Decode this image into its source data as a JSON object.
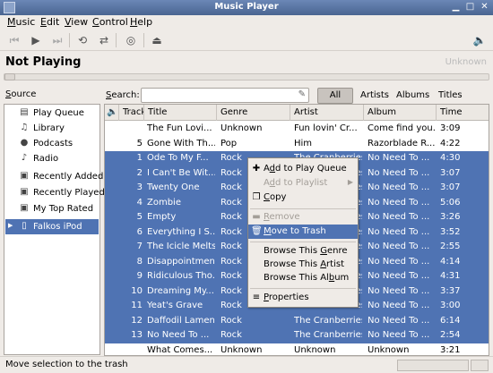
{
  "window": {
    "title": "Music Player"
  },
  "menu": [
    {
      "label": "Music",
      "u": "M",
      "rest": "usic"
    },
    {
      "label": "Edit",
      "u": "E",
      "rest": "dit"
    },
    {
      "label": "View",
      "u": "V",
      "rest": "iew"
    },
    {
      "label": "Control",
      "u": "C",
      "rest": "ontrol"
    },
    {
      "label": "Help",
      "u": "H",
      "rest": "elp"
    }
  ],
  "toolbar": {
    "icons": [
      "previous-icon",
      "play-icon",
      "next-icon",
      "repeat-icon",
      "shuffle-icon",
      "burn-disc-icon",
      "eject-icon",
      "volume-icon"
    ]
  },
  "now_playing": {
    "title": "Not Playing",
    "artist": "Unknown"
  },
  "source": {
    "label_u": "S",
    "label_rest": "ource",
    "items": [
      {
        "label": "Play Queue",
        "icon": "play-queue-icon"
      },
      {
        "label": "Library",
        "icon": "library-icon"
      },
      {
        "label": "Podcasts",
        "icon": "podcast-icon"
      },
      {
        "label": "Radio",
        "icon": "radio-icon"
      },
      {
        "label": "Recently Added",
        "icon": "playlist-icon"
      },
      {
        "label": "Recently Played",
        "icon": "playlist-icon"
      },
      {
        "label": "My Top Rated",
        "icon": "playlist-icon"
      },
      {
        "label": "Falkos iPod",
        "icon": "ipod-icon"
      }
    ]
  },
  "search": {
    "label_u": "S",
    "label_rest": "earch:",
    "value": "",
    "filters": [
      "All",
      "Artists",
      "Albums",
      "Titles"
    ]
  },
  "table": {
    "columns": [
      "Track",
      "Title",
      "Genre",
      "Artist",
      "Album",
      "Time"
    ],
    "rows": [
      {
        "track": "",
        "title": "The Fun Lovi...",
        "genre": "Unknown",
        "artist": "Fun lovin' Cr...",
        "album": "Come find you...",
        "time": "3:09",
        "sel": false
      },
      {
        "track": "5",
        "title": "Gone With Th...",
        "genre": "Pop",
        "artist": "Him",
        "album": "Razorblade R...",
        "time": "4:22",
        "sel": false
      },
      {
        "track": "1",
        "title": "Ode To My F...",
        "genre": "Rock",
        "artist": "The Cranberries",
        "album": "No Need To ...",
        "time": "4:30",
        "sel": true
      },
      {
        "track": "2",
        "title": "I Can't Be Wit...",
        "genre": "Rock",
        "artist": "The Cranberries",
        "album": "No Need To ...",
        "time": "3:07",
        "sel": true
      },
      {
        "track": "3",
        "title": "Twenty One",
        "genre": "Rock",
        "artist": "The Cranberries",
        "album": "No Need To ...",
        "time": "3:07",
        "sel": true
      },
      {
        "track": "4",
        "title": "Zombie",
        "genre": "Rock",
        "artist": "The Cranberries",
        "album": "No Need To ...",
        "time": "5:06",
        "sel": true
      },
      {
        "track": "5",
        "title": "Empty",
        "genre": "Rock",
        "artist": "The Cranberries",
        "album": "No Need To ...",
        "time": "3:26",
        "sel": true
      },
      {
        "track": "6",
        "title": "Everything I S...",
        "genre": "Rock",
        "artist": "The Cranberries",
        "album": "No Need To ...",
        "time": "3:52",
        "sel": true
      },
      {
        "track": "7",
        "title": "The Icicle Melts",
        "genre": "Rock",
        "artist": "The Cranberries",
        "album": "No Need To ...",
        "time": "2:55",
        "sel": true
      },
      {
        "track": "8",
        "title": "Disappointment",
        "genre": "Rock",
        "artist": "The Cranberries",
        "album": "No Need To ...",
        "time": "4:14",
        "sel": true
      },
      {
        "track": "9",
        "title": "Ridiculous Tho...",
        "genre": "Rock",
        "artist": "The Cranberries",
        "album": "No Need To ...",
        "time": "4:31",
        "sel": true
      },
      {
        "track": "10",
        "title": "Dreaming My...",
        "genre": "Rock",
        "artist": "The Cranberries",
        "album": "No Need To ...",
        "time": "3:37",
        "sel": true
      },
      {
        "track": "11",
        "title": "Yeat's Grave",
        "genre": "Rock",
        "artist": "The Cranberries",
        "album": "No Need To ...",
        "time": "3:00",
        "sel": true
      },
      {
        "track": "12",
        "title": "Daffodil Lament",
        "genre": "Rock",
        "artist": "The Cranberries",
        "album": "No Need To ...",
        "time": "6:14",
        "sel": true
      },
      {
        "track": "13",
        "title": "No Need To ...",
        "genre": "Rock",
        "artist": "The Cranberries",
        "album": "No Need To ...",
        "time": "2:54",
        "sel": true
      },
      {
        "track": "",
        "title": "What Comes...",
        "genre": "Unknown",
        "artist": "Unknown",
        "album": "Unknown",
        "time": "3:21",
        "sel": false
      }
    ]
  },
  "context_menu": {
    "items": [
      {
        "pre": "A",
        "u": "d",
        "post": "d to Play Queue",
        "icon": "add-icon",
        "state": "normal"
      },
      {
        "pre": "A",
        "u": "d",
        "post": "d to Playlist",
        "icon": "",
        "state": "disabled",
        "submenu": "▶"
      },
      {
        "pre": "",
        "u": "C",
        "post": "opy",
        "icon": "copy-icon",
        "state": "normal"
      },
      {
        "pre": "",
        "u": "R",
        "post": "emove",
        "icon": "remove-icon",
        "state": "disabled"
      },
      {
        "pre": "",
        "u": "M",
        "post": "ove to Trash",
        "icon": "trash-icon",
        "state": "highlighted"
      },
      {
        "pre": "Browse This ",
        "u": "G",
        "post": "enre",
        "icon": "",
        "state": "normal"
      },
      {
        "pre": "Browse This ",
        "u": "A",
        "post": "rtist",
        "icon": "",
        "state": "normal"
      },
      {
        "pre": "Browse This Al",
        "u": "b",
        "post": "um",
        "icon": "",
        "state": "normal"
      },
      {
        "pre": "",
        "u": "P",
        "post": "roperties",
        "icon": "properties-icon",
        "state": "normal"
      }
    ]
  },
  "status": {
    "text": "Move selection to the trash"
  },
  "colors": {
    "selection": "#4f73b3",
    "titlebar": "#5a78a8"
  }
}
